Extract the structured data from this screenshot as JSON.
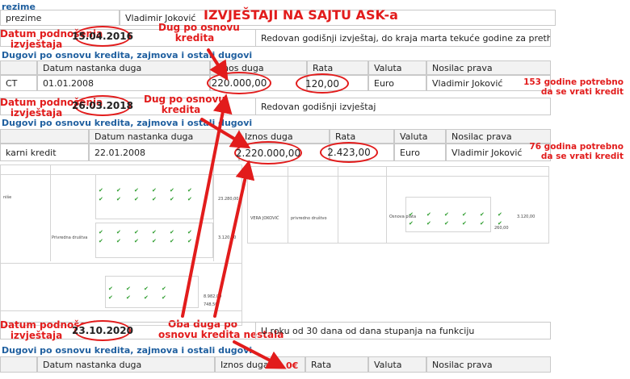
{
  "colors": {
    "accent": "#e21c1c",
    "section": "#1f5f9f",
    "check": "#2a9b2a"
  },
  "title": "IZVJEŠTAJI NA SAJTU ASK-a",
  "top": {
    "label_fragment": "rezime",
    "row_label": "prezime",
    "row_value": "Vladimir Joković"
  },
  "report1": {
    "date_label_line1": "Datum podnošenja",
    "date_label_line2": "izvještaja",
    "date": "15.04.2016",
    "description": "Redovan godišnji izvještaj, do kraja marta tekuće godine za prethodnu godinu",
    "debt_note_line1": "Dug po osnovu",
    "debt_note_line2": "kredita",
    "section": "Dugovi po osnovu kredita, zajmova i ostali dugovi",
    "headers": [
      "Datum nastanka duga",
      "Iznos duga",
      "Rata",
      "Valuta",
      "Nosilac prava"
    ],
    "row": {
      "type": "CT",
      "date": "01.01.2008",
      "amount": "220.000,00",
      "rate": "120,00",
      "currency": "Euro",
      "holder": "Vladimir Joković"
    },
    "side_note_line1": "153 godine potrebno",
    "side_note_line2": "da se vrati kredit"
  },
  "report2": {
    "date_label_line1": "Datum podnošenja",
    "date_label_line2": "izvještaja",
    "date": "26.03.2018",
    "description": "Redovan godišnji izvještaj",
    "debt_note_line1": "Dug po osnovu",
    "debt_note_line2": "kredita",
    "section": "Dugovi po osnovu kredita, zajmova i ostali dugovi",
    "headers": [
      "Datum nastanka duga",
      "Iznos duga",
      "Rata",
      "Valuta",
      "Nosilac prava"
    ],
    "row": {
      "type": "karni kredit",
      "date": "22.01.2008",
      "amount": "2.220.000,00",
      "rate": "2.423,00",
      "currency": "Euro",
      "holder": "Vladimir Joković"
    },
    "side_note_line1": "76 godina potrebno",
    "side_note_line2": "da se vrati kredit"
  },
  "middle": {
    "left_rows": [
      "niše",
      "Privredna društva"
    ],
    "left_values": [
      "23.280,00",
      "3.120,00"
    ],
    "right_name": "VERA JOKOVIĆ",
    "right_org": "privredno društvo",
    "right_value": "3.120,00",
    "income_label": "Osnova plata",
    "amount_label": "260,00",
    "lower_value": "748,50",
    "lower_total": "8.982,00",
    "months": [
      "1",
      "2",
      "3",
      "4",
      "5",
      "6",
      "7",
      "8",
      "9",
      "10",
      "11",
      "12"
    ]
  },
  "annotation_bottom": {
    "line1": "Oba duga po",
    "line2": "osnovu kredita nestala"
  },
  "report3": {
    "date_label_line1": "Datum podnošenja",
    "date_label_line2": "izvještaja",
    "date": "23.10.2020",
    "description": "U roku od 30 dana od dana stupanja na funkciju",
    "section": "Dugovi po osnovu kredita, zajmova i ostali dugovi",
    "headers": [
      "Datum nastanka duga",
      "Iznos duga",
      "Rata",
      "Valuta",
      "Nosilac prava"
    ],
    "zero": "0€"
  }
}
